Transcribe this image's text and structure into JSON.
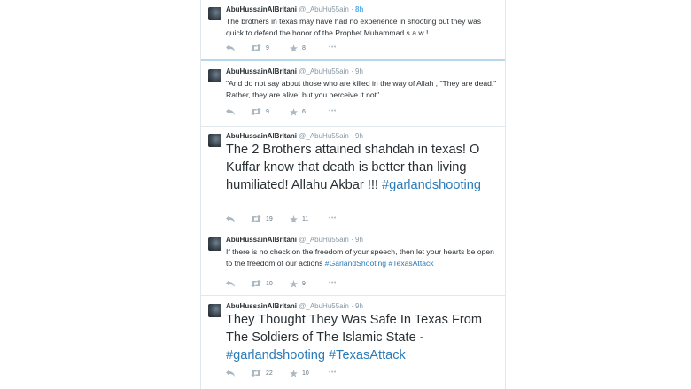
{
  "tweets": [
    {
      "fullname": "AbuHussainAlBritani",
      "username": "@_AbuHu55ain",
      "dot": "·",
      "time": "8h",
      "segments": [
        "The brothers in texas may have had no experience in shooting but they was quick to defend the honor of the Prophet Muhammad s.a.w !"
      ],
      "retweets": "9",
      "favorites": "8",
      "more": "•••"
    },
    {
      "fullname": "AbuHussainAlBritani",
      "username": "@_AbuHu55ain",
      "dot": "·",
      "time": "9h",
      "segments": [
        "\"And do not say about those who are killed in the way of Allah , \"They are dead.\" Rather, they are alive, but you perceive it not\""
      ],
      "retweets": "9",
      "favorites": "6",
      "more": "•••"
    },
    {
      "fullname": "AbuHussainAlBritani",
      "username": "@_AbuHu55ain",
      "dot": "·",
      "time": "9h",
      "segments": [
        "The 2 Brothers attained shahdah in texas! O Kuffar know that death is better than living humiliated! Allahu Akbar !!! ",
        "#garlandshooting"
      ],
      "retweets": "19",
      "favorites": "11",
      "more": "•••"
    },
    {
      "fullname": "AbuHussainAlBritani",
      "username": "@_AbuHu55ain",
      "dot": "·",
      "time": "9h",
      "segments": [
        "If there is no check on the freedom of your speech, then let your hearts be open to the freedom of our actions ",
        "#GarlandShooting",
        " ",
        "#TexasAttack"
      ],
      "retweets": "10",
      "favorites": "9",
      "more": "•••"
    },
    {
      "fullname": "AbuHussainAlBritani",
      "username": "@_AbuHu55ain",
      "dot": "·",
      "time": "9h",
      "segments": [
        "They Thought They Was Safe In Texas From The Soldiers of The Islamic State - ",
        "#garlandshooting",
        " ",
        "#TexasAttack"
      ],
      "retweets": "22",
      "favorites": "10",
      "more": "•••"
    }
  ]
}
